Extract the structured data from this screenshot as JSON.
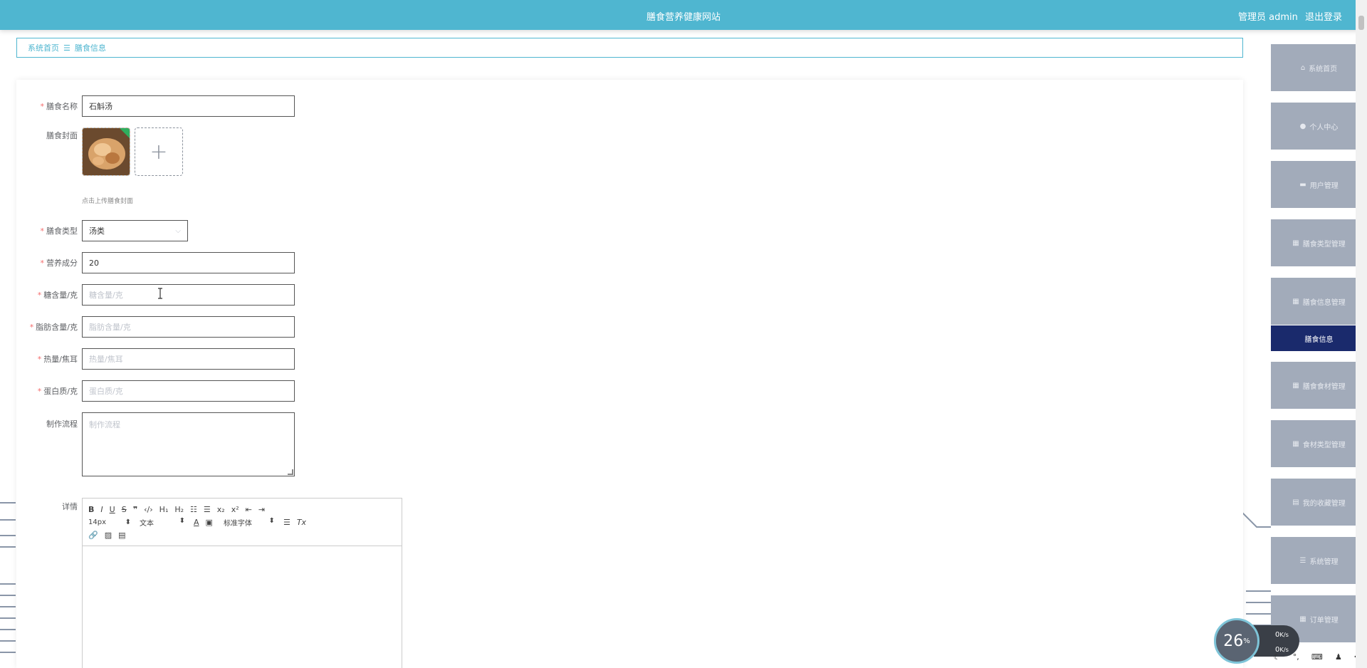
{
  "header": {
    "title": "膳食营养健康网站",
    "user_label": "管理员 admin",
    "logout_label": "退出登录"
  },
  "breadcrumb": {
    "home": "系统首页",
    "current": "膳食信息"
  },
  "form": {
    "name": {
      "label": "膳食名称",
      "value": "石斛汤"
    },
    "cover": {
      "label": "膳食封面",
      "tip": "点击上传膳食封面"
    },
    "type": {
      "label": "膳食类型",
      "value": "汤类"
    },
    "nutrition": {
      "label": "营养成分",
      "value": "20"
    },
    "sugar": {
      "label": "糖含量/克",
      "placeholder": "糖含量/克"
    },
    "fat": {
      "label": "脂肪含量/克",
      "placeholder": "脂肪含量/克"
    },
    "calories": {
      "label": "热量/焦耳",
      "placeholder": "热量/焦耳"
    },
    "protein": {
      "label": "蛋白质/克",
      "placeholder": "蛋白质/克"
    },
    "process": {
      "label": "制作流程",
      "placeholder": "制作流程"
    },
    "detail": {
      "label": "详情"
    }
  },
  "editor": {
    "font_size": "14px",
    "header": "文本",
    "font": "标准字体"
  },
  "sidebar": {
    "items": [
      {
        "label": "系统首页",
        "icon": "home-icon"
      },
      {
        "label": "个人中心",
        "icon": "user-icon"
      },
      {
        "label": "用户管理",
        "icon": "briefcase-icon"
      },
      {
        "label": "膳食类型管理",
        "icon": "grid-icon"
      },
      {
        "label": "膳食信息管理",
        "icon": "grid-icon"
      },
      {
        "label": "膳食信息",
        "icon": ""
      },
      {
        "label": "膳食食材管理",
        "icon": "grid-icon"
      },
      {
        "label": "食材类型管理",
        "icon": "grid-icon"
      },
      {
        "label": "我的收藏管理",
        "icon": "clipboard-icon"
      },
      {
        "label": "系统管理",
        "icon": "menu-icon"
      },
      {
        "label": "订单管理",
        "icon": "table-icon"
      }
    ]
  },
  "widget": {
    "percent": "26",
    "percent_unit": "%",
    "upload_speed": "0",
    "download_speed": "0",
    "speed_unit": "K/s"
  },
  "colors": {
    "header": "#4fb6d0",
    "sidebar": "#a2abba",
    "sidebar_active": "#1a2a6c",
    "required": "#f56c6c"
  }
}
